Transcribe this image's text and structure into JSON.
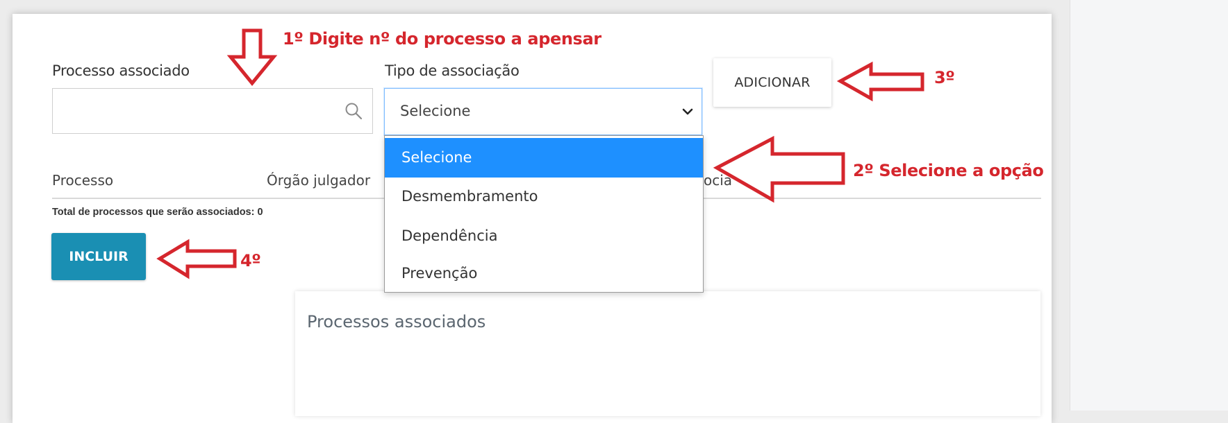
{
  "form": {
    "processo_label": "Processo associado",
    "tipo_label": "Tipo de associação",
    "tipo_selected": "Selecione",
    "add_button": "ADICIONAR",
    "tipo_options": [
      "Selecione",
      "Desmembramento",
      "Dependência",
      "Prevenção"
    ]
  },
  "table": {
    "headers": [
      "Processo",
      "Órgão julgador",
      "ocia"
    ],
    "total_text": "Total de processos que serão associados: 0"
  },
  "actions": {
    "incluir_button": "INCLUIR"
  },
  "associated_panel": {
    "title": "Processos associados"
  },
  "annotations": {
    "step1": "1º Digite nº do processo a apensar",
    "step2": "2º Selecione a opção",
    "step3": "3º",
    "step4": "4º",
    "color": "#d5262d"
  },
  "colors": {
    "accent_button": "#1a8fb3",
    "dropdown_highlight": "#1e90ff",
    "focus_border": "#80bdff"
  },
  "icons": [
    "search-icon",
    "chevron-down-icon"
  ]
}
